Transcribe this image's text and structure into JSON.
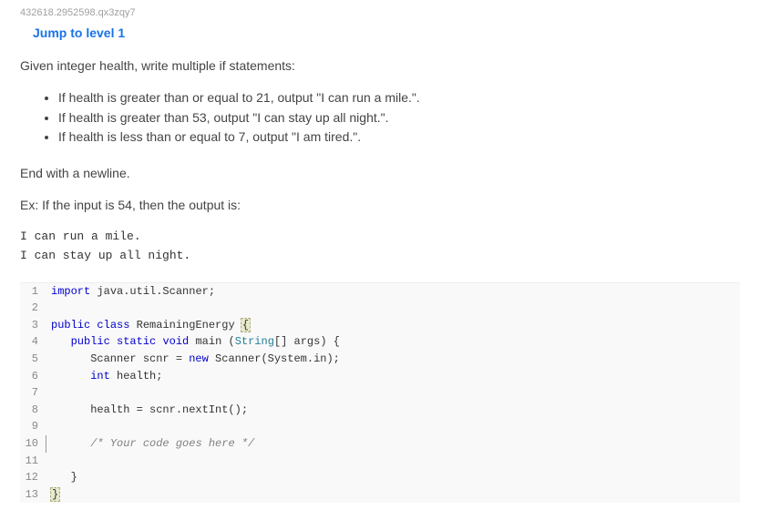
{
  "qid": "432618.2952598.qx3zqy7",
  "jump_link": "Jump to level 1",
  "intro": "Given integer health, write multiple if statements:",
  "bullets": [
    "If health is greater than or equal to 21, output \"I can run a mile.\".",
    "If health is greater than 53, output \"I can stay up all night.\".",
    "If health is less than or equal to 7, output \"I am tired.\"."
  ],
  "end_line": "End with a newline.",
  "example_prefix": "Ex: If the input is 54, then the output is:",
  "example_output": "I can run a mile.\nI can stay up all night.",
  "code": {
    "lines": [
      {
        "n": 1,
        "html": "<span class='kw'>import</span> java.util.Scanner;"
      },
      {
        "n": 2,
        "html": ""
      },
      {
        "n": 3,
        "html": "<span class='kw'>public</span> <span class='kw'>class</span> RemainingEnergy <span class='brace-hl'>{</span>"
      },
      {
        "n": 4,
        "html": "   <span class='kw'>public</span> <span class='kw'>static</span> <span class='kw'>void</span> main (<span class='type'>String</span>[] args) {"
      },
      {
        "n": 5,
        "html": "      Scanner scnr = <span class='kw'>new</span> Scanner(System.in);"
      },
      {
        "n": 6,
        "html": "      <span class='kw'>int</span> health;"
      },
      {
        "n": 7,
        "html": ""
      },
      {
        "n": 8,
        "html": "      health = scnr.nextInt();"
      },
      {
        "n": 9,
        "html": ""
      },
      {
        "n": 10,
        "html": "      <span class='comment'>/* Your code goes here */</span>",
        "cursor": true
      },
      {
        "n": 11,
        "html": ""
      },
      {
        "n": 12,
        "html": "   }"
      },
      {
        "n": 13,
        "html": "<span class='brace-hl'>}</span>"
      }
    ]
  }
}
